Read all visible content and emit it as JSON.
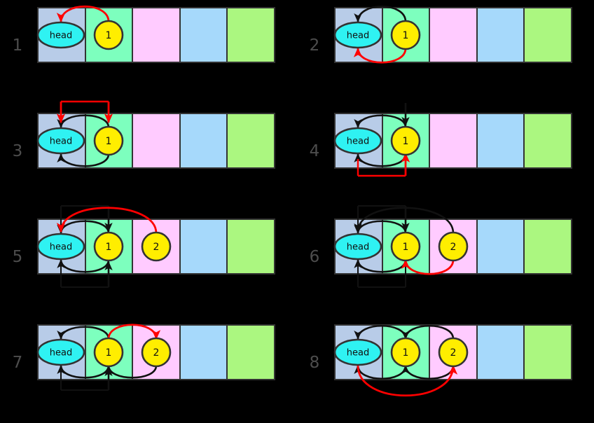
{
  "figure": {
    "background_color": "#000000",
    "columns": 2,
    "rows": 4,
    "panel_count": 8
  },
  "colors": {
    "cell_head": "#b8cce8",
    "cell_green": "#7dffbe",
    "cell_pink": "#ffcbff",
    "cell_blue": "#a6d9fb",
    "cell_lime": "#abf780",
    "cell_border": "#333333",
    "head_fill": "#2ff2f2",
    "node_fill": "#ffee00",
    "node_stroke": "#333333",
    "arrow_black": "#111111",
    "arrow_red": "#ff0000",
    "bracket_dark": "#333333",
    "panel_number": "#4d4d4d"
  },
  "labels": {
    "head": "head",
    "node_1": "1",
    "node_2": "2"
  },
  "panels": [
    {
      "number": "1",
      "cells": [
        "head",
        "green",
        "pink",
        "blue",
        "lime"
      ],
      "nodes": [
        "head",
        "1"
      ],
      "arrows": [
        {
          "color": "red",
          "from": "node-1-top",
          "to": "head-top",
          "style": "curve-over"
        }
      ]
    },
    {
      "number": "2",
      "cells": [
        "head",
        "green",
        "pink",
        "blue",
        "lime"
      ],
      "nodes": [
        "head",
        "1"
      ],
      "arrows": [
        {
          "color": "black",
          "from": "node-1-top",
          "to": "head-top",
          "style": "curve-over"
        },
        {
          "color": "red",
          "from": "node-1-bottom",
          "to": "head-bottom",
          "style": "curve-under"
        }
      ]
    },
    {
      "number": "3",
      "cells": [
        "head",
        "green",
        "pink",
        "blue",
        "lime"
      ],
      "nodes": [
        "head",
        "1"
      ],
      "arrows": [
        {
          "color": "black",
          "from": "node-1-top",
          "to": "head-top",
          "style": "curve-over"
        },
        {
          "color": "black",
          "from": "node-1-bottom",
          "to": "head-bottom",
          "style": "curve-under"
        },
        {
          "color": "red",
          "from": "bracket-top-left",
          "to": "head-top",
          "style": "bracket-down"
        },
        {
          "color": "red",
          "from": "bracket-top-right",
          "to": "node-1-top",
          "style": "bracket-down"
        }
      ]
    },
    {
      "number": "4",
      "cells": [
        "head",
        "green",
        "pink",
        "blue",
        "lime"
      ],
      "nodes": [
        "head",
        "1"
      ],
      "arrows": [
        {
          "color": "black",
          "from": "node-1-top",
          "to": "head-top",
          "style": "curve-over"
        },
        {
          "color": "black",
          "from": "node-1-bottom",
          "to": "head-bottom",
          "style": "curve-under"
        },
        {
          "color": "black",
          "from": "above",
          "to": "node-1-top",
          "style": "down-into"
        },
        {
          "color": "red",
          "from": "head-bottom",
          "to": "node-1-bottom",
          "style": "bracket-up"
        }
      ]
    },
    {
      "number": "5",
      "cells": [
        "head",
        "green",
        "pink",
        "blue",
        "lime"
      ],
      "nodes": [
        "head",
        "1",
        "2"
      ],
      "arrows": [
        {
          "color": "black",
          "from": "node-1-top",
          "to": "head-top",
          "style": "curve-over"
        },
        {
          "color": "black",
          "from": "node-1-bottom",
          "to": "head-bottom",
          "style": "curve-under"
        },
        {
          "color": "black",
          "from": "bracket-top",
          "to": "node-1-top",
          "style": "bracket-down"
        },
        {
          "color": "black",
          "from": "bracket-bottom",
          "to": "node-1-bottom",
          "style": "bracket-up"
        },
        {
          "color": "red",
          "from": "node-2-top",
          "to": "head-top",
          "style": "curve-over-long"
        }
      ]
    },
    {
      "number": "6",
      "cells": [
        "head",
        "green",
        "pink",
        "blue",
        "lime"
      ],
      "nodes": [
        "head",
        "1",
        "2"
      ],
      "arrows": [
        {
          "color": "black",
          "from": "node-1-top",
          "to": "head-top",
          "style": "curve-over"
        },
        {
          "color": "black",
          "from": "node-1-bottom",
          "to": "head-bottom",
          "style": "curve-under"
        },
        {
          "color": "black",
          "from": "bracket-top",
          "to": "node-1-top",
          "style": "bracket-down"
        },
        {
          "color": "black",
          "from": "node-2-top",
          "to": "head-top",
          "style": "curve-over-long"
        },
        {
          "color": "red",
          "from": "node-2-bottom",
          "to": "node-1-bottom",
          "style": "curve-under"
        }
      ]
    },
    {
      "number": "7",
      "cells": [
        "head",
        "green",
        "pink",
        "blue",
        "lime"
      ],
      "nodes": [
        "head",
        "1",
        "2"
      ],
      "arrows": [
        {
          "color": "black",
          "from": "node-1-top",
          "to": "head-top",
          "style": "curve-over"
        },
        {
          "color": "black",
          "from": "node-1-bottom",
          "to": "head-bottom",
          "style": "curve-under"
        },
        {
          "color": "black",
          "from": "bracket-bottom",
          "to": "node-1-bottom",
          "style": "bracket-up"
        },
        {
          "color": "black",
          "from": "node-2-bottom",
          "to": "node-1-bottom",
          "style": "curve-under"
        },
        {
          "color": "red",
          "from": "node-1-top",
          "to": "node-2-top",
          "style": "curve-over"
        }
      ]
    },
    {
      "number": "8",
      "cells": [
        "head",
        "green",
        "pink",
        "blue",
        "lime"
      ],
      "nodes": [
        "head",
        "1",
        "2"
      ],
      "arrows": [
        {
          "color": "black",
          "from": "node-1-top",
          "to": "head-top",
          "style": "curve-over"
        },
        {
          "color": "black",
          "from": "node-1-bottom",
          "to": "head-bottom",
          "style": "curve-under"
        },
        {
          "color": "black",
          "from": "node-2-top",
          "to": "node-1-top",
          "style": "curve-over"
        },
        {
          "color": "black",
          "from": "node-2-bottom",
          "to": "node-1-bottom",
          "style": "curve-under"
        },
        {
          "color": "red",
          "from": "head-bottom",
          "to": "node-2-bottom",
          "style": "curve-under-long"
        }
      ]
    }
  ]
}
